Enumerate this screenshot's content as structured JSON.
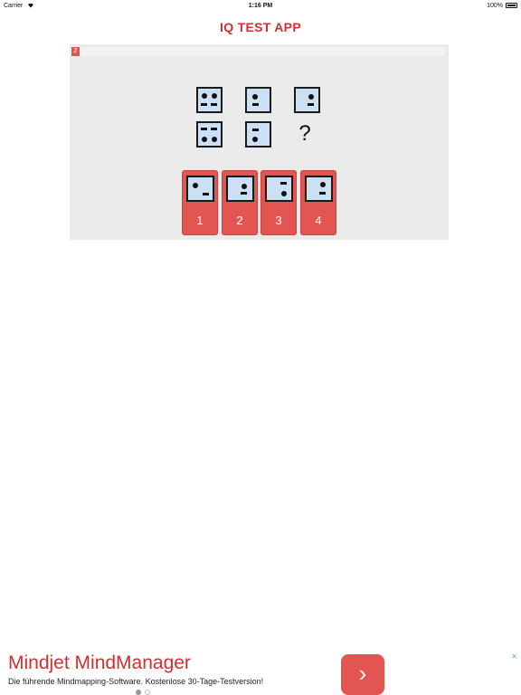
{
  "status_bar": {
    "carrier": "Carrier",
    "time": "1:16 PM",
    "battery": "100%"
  },
  "app": {
    "title": "IQ TEST APP"
  },
  "question": {
    "number": "2",
    "progress_fraction": 0.0,
    "missing_symbol": "?"
  },
  "answers": [
    {
      "label": "1"
    },
    {
      "label": "2"
    },
    {
      "label": "3"
    },
    {
      "label": "4"
    }
  ],
  "ad": {
    "title": "Mindjet MindManager",
    "subtitle": "Die führende Mindmapping-Software. Kostenlose 30-Tage-Testversion!",
    "arrow": "›",
    "close": "✕"
  },
  "icons": {
    "wifi": "wifi-icon",
    "battery": "battery-icon",
    "next": "chevron-right-icon"
  },
  "colors": {
    "accent": "#e25550",
    "title": "#d32f2f",
    "tile_fill": "#cce0f5",
    "panel": "#ebebeb"
  }
}
